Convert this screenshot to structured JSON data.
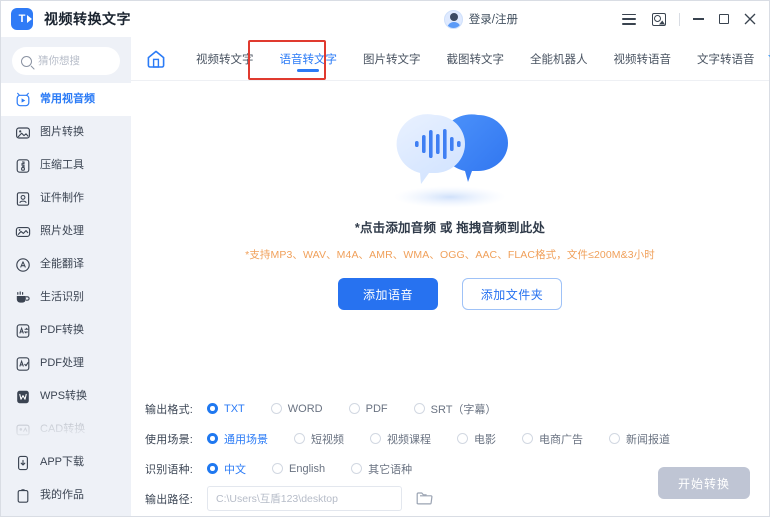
{
  "window": {
    "title": "视频转换文字",
    "logo_letter": "T",
    "account_label": "登录/注册",
    "controls": {
      "menu": "menu-icon",
      "screenshot": "screenshot-icon",
      "minimize": "–",
      "maximize": "▢",
      "close": "✕"
    }
  },
  "sidebar": {
    "search": {
      "placeholder": "猜你想搜",
      "value": ""
    },
    "items": [
      {
        "label": "常用视音频",
        "icon": "video-play-icon",
        "active": true,
        "faded": false
      },
      {
        "label": "图片转换",
        "icon": "image-convert-icon",
        "active": false,
        "faded": false
      },
      {
        "label": "压缩工具",
        "icon": "compress-icon",
        "active": false,
        "faded": false
      },
      {
        "label": "证件制作",
        "icon": "id-card-icon",
        "active": false,
        "faded": false
      },
      {
        "label": "照片处理",
        "icon": "photo-edit-icon",
        "active": false,
        "faded": false
      },
      {
        "label": "全能翻译",
        "icon": "translate-icon",
        "active": false,
        "faded": false
      },
      {
        "label": "生活识别",
        "icon": "life-recognition-icon",
        "active": false,
        "faded": false
      },
      {
        "label": "PDF转换",
        "icon": "pdf-convert-icon",
        "active": false,
        "faded": false
      },
      {
        "label": "PDF处理",
        "icon": "pdf-edit-icon",
        "active": false,
        "faded": false
      },
      {
        "label": "WPS转换",
        "icon": "wps-icon",
        "active": false,
        "faded": false
      },
      {
        "label": "CAD转换",
        "icon": "cad-icon",
        "active": false,
        "faded": true
      },
      {
        "label": "APP下载",
        "icon": "app-download-icon",
        "active": false,
        "faded": false
      },
      {
        "label": "我的作品",
        "icon": "my-works-icon",
        "active": false,
        "faded": false
      }
    ]
  },
  "tabs": {
    "home_icon": "home-icon",
    "more_icon": "chevron-down-icon",
    "items": [
      {
        "label": "视频转文字",
        "active": false
      },
      {
        "label": "语音转文字",
        "active": true
      },
      {
        "label": "图片转文字",
        "active": false
      },
      {
        "label": "截图转文字",
        "active": false
      },
      {
        "label": "全能机器人",
        "active": false
      },
      {
        "label": "视频转语音",
        "active": false
      },
      {
        "label": "文字转语音",
        "active": false
      }
    ]
  },
  "dropzone": {
    "title": "*点击添加音频 或 拖拽音频到此处",
    "subtitle": "*支持MP3、WAV、M4A、AMR、WMA、OGG、AAC、FLAC格式，文件≤200M&3小时",
    "primary_button": "添加语音",
    "secondary_button": "添加文件夹"
  },
  "options": {
    "format": {
      "label": "输出格式:",
      "choices": [
        {
          "label": "TXT",
          "selected": true
        },
        {
          "label": "WORD",
          "selected": false
        },
        {
          "label": "PDF",
          "selected": false
        },
        {
          "label": "SRT（字幕）",
          "selected": false
        }
      ]
    },
    "scene": {
      "label": "使用场景:",
      "choices": [
        {
          "label": "通用场景",
          "selected": true
        },
        {
          "label": "短视频",
          "selected": false
        },
        {
          "label": "视频课程",
          "selected": false
        },
        {
          "label": "电影",
          "selected": false
        },
        {
          "label": "电商广告",
          "selected": false
        },
        {
          "label": "新闻报道",
          "selected": false
        }
      ]
    },
    "language": {
      "label": "识别语种:",
      "choices": [
        {
          "label": "中文",
          "selected": true
        },
        {
          "label": "English",
          "selected": false
        },
        {
          "label": "其它语种",
          "selected": false
        }
      ]
    },
    "output_path": {
      "label": "输出路径:",
      "value": "C:\\Users\\互盾123\\desktop",
      "browse_icon": "folder-icon"
    }
  },
  "actions": {
    "start_label": "开始转换",
    "start_disabled": true
  },
  "colors": {
    "accent": "#2772f0",
    "tab_active": "#2b7bf6",
    "highlight_box": "#e03a2f",
    "warning_text": "#f0a05a",
    "sidebar_bg": "#eef1f7",
    "disabled_button": "#bfc5d4"
  }
}
